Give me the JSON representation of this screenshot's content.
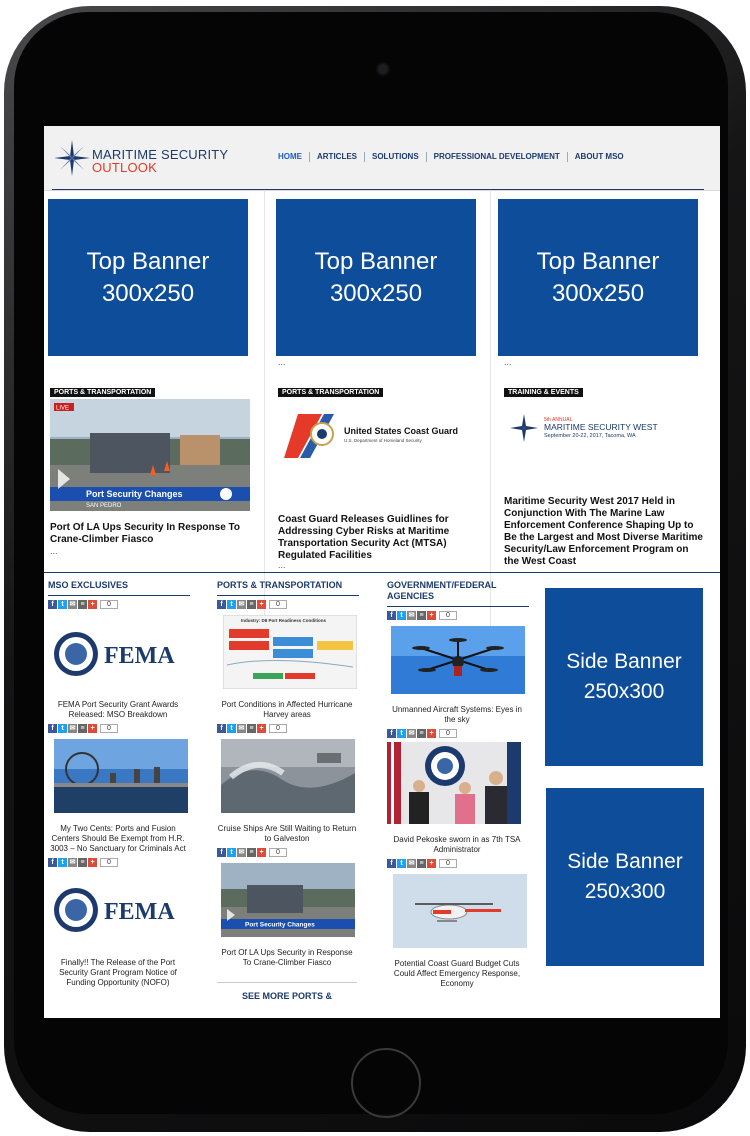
{
  "site": {
    "logo_line1": "MARITIME SECURITY",
    "logo_line2": "OUTLOOK"
  },
  "nav": {
    "items": [
      "HOME",
      "ARTICLES",
      "SOLUTIONS",
      "PROFESSIONAL DEVELOPMENT",
      "ABOUT MSO"
    ]
  },
  "top_banners": [
    {
      "line1": "Top Banner",
      "line2": "300x250"
    },
    {
      "line1": "Top Banner",
      "line2": "300x250"
    },
    {
      "line1": "Top Banner",
      "line2": "300x250"
    }
  ],
  "ellipsis": "...",
  "featured": [
    {
      "category": "PORTS & TRANSPORTATION",
      "title": "Port Of LA Ups Security In Response To Crane-Climber Fiasco",
      "video_caption": "Port Security Changes",
      "video_live": "LIVE",
      "video_location": "SAN PEDRO"
    },
    {
      "category": "PORTS & TRANSPORTATION",
      "title": "Coast Guard Releases Guidlines for Addressing Cyber Risks at Maritime Transportation Security Act (MTSA) Regulated Facilities",
      "logo_line1": "United States Coast Guard",
      "logo_line2": "U.S. Department of Homeland Security"
    },
    {
      "category": "TRAINING & EVENTS",
      "title": "Maritime Security West 2017 Held in Conjunction With The Marine Law Enforcement Conference Shaping Up to Be the Largest and Most Diverse Maritime Security/Law Enforcement Program on the West Coast",
      "event_annual": "5th ANNUAL",
      "event_name": "MARITIME SECURITY WEST",
      "event_dates": "September 20-22, 2017, Tacoma, WA"
    }
  ],
  "sections": [
    {
      "heading": "MSO EXCLUSIVES",
      "share_count": "0",
      "items": [
        {
          "caption": "FEMA Port Security Grant Awards Released:  MSO Breakdown",
          "image_text": "FEMA"
        },
        {
          "caption": "My Two Cents:  Ports and Fusion Centers Should Be Exempt from H.R. 3003 – No Sanctuary for Criminals Act"
        },
        {
          "caption": "Finally!! The Release of the Port Security Grant Program Notice of Funding Opportunity (NOFO)",
          "image_text": "FEMA"
        }
      ]
    },
    {
      "heading": "PORTS & TRANSPORTATION",
      "share_count": "0",
      "items": [
        {
          "caption": "Port Conditions in Affected Hurricane Harvey areas",
          "image_text": "Industry: D8 Port Readiness Conditions"
        },
        {
          "caption": "Cruise Ships Are Still Waiting to Return to Galveston"
        },
        {
          "caption": "Port Of LA Ups Security in Response To Crane-Climber Fiasco",
          "image_text": "Port Security Changes"
        }
      ],
      "see_more": "SEE MORE PORTS &"
    },
    {
      "heading": "GOVERNMENT/FEDERAL AGENCIES",
      "share_count": "0",
      "items": [
        {
          "caption": "Unmanned Aircraft Systems: Eyes in the sky"
        },
        {
          "caption": "David Pekoske sworn in as 7th TSA Administrator"
        },
        {
          "caption": "Potential Coast Guard Budget Cuts Could Affect Emergency Response, Economy"
        }
      ]
    }
  ],
  "side_banners": [
    {
      "line1": "Side Banner",
      "line2": "250x300"
    },
    {
      "line1": "Side Banner",
      "line2": "250x300"
    }
  ],
  "colors": {
    "brand_blue": "#0d4d99",
    "nav_blue": "#1c3a6e",
    "accent_red": "#e33b2b"
  }
}
